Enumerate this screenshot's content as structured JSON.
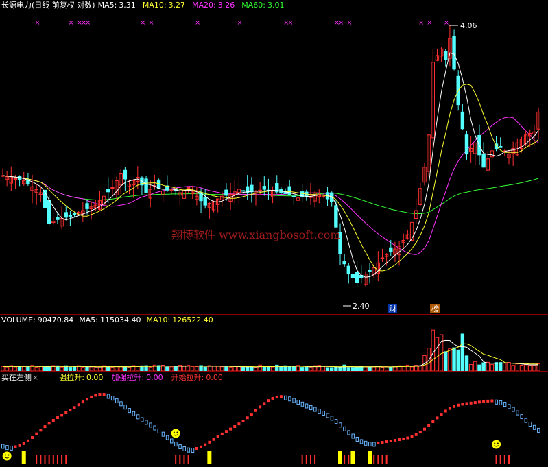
{
  "colors": {
    "background": "#000000",
    "divider": "#8b0000",
    "candle_up": "#ff3030",
    "candle_down": "#54ffff",
    "ma5": "#ffffff",
    "ma10": "#ffff33",
    "ma20": "#ff33ff",
    "ma60": "#33ff33",
    "vol_ma5": "#ffffff",
    "vol_ma10": "#ffff33",
    "indicator_red": "#ff3030",
    "indicator_blue": "#6ab6ff",
    "signal_yellow": "#ffff00",
    "watermark": "#b02020"
  },
  "price_panel": {
    "legend": {
      "title": "长源电力(日线 前复权 对数)",
      "ma5_label": "MA5:",
      "ma5_value": "3.31",
      "ma10_label": "MA10:",
      "ma10_value": "3.27",
      "ma20_label": "MA20:",
      "ma20_value": "3.26",
      "ma60_label": "MA60:",
      "ma60_value": "3.01"
    },
    "high_label": "4.06",
    "low_label": "2.40",
    "badges": [
      "财",
      "榜"
    ],
    "watermark": "翔博软件 www.xiangbosoft.com",
    "marker_glyph": "×"
  },
  "volume_panel": {
    "legend": {
      "volume_label": "VOLUME:",
      "volume_value": "90470.84",
      "ma5_label": "MA5:",
      "ma5_value": "115034.40",
      "ma10_label": "MA10:",
      "ma10_value": "126522.40"
    }
  },
  "indicator_panel": {
    "legend": {
      "name": "买在左侧",
      "close_glyph": "×",
      "strong_label": "强拉升:",
      "strong_value": "0.00",
      "enhanced_label": "加强拉升:",
      "enhanced_value": "0.00",
      "start_label": "开始拉升:",
      "start_value": "0.00"
    }
  },
  "chart_data": {
    "type": "candlestick",
    "title": "长源电力(日线 前复权 对数)",
    "scale": "log",
    "ylim": [
      2.35,
      4.12
    ],
    "visible_high": 4.06,
    "visible_low": 2.4,
    "series": [
      {
        "name": "MA5",
        "last": 3.31
      },
      {
        "name": "MA10",
        "last": 3.27
      },
      {
        "name": "MA20",
        "last": 3.26
      },
      {
        "name": "MA60",
        "last": 3.01
      }
    ],
    "volume": {
      "last": 90470.84,
      "ma5": 115034.4,
      "ma10": 126522.4
    },
    "indicator": {
      "name": "买在左侧",
      "强拉升": 0.0,
      "加强拉升": 0.0,
      "开始拉升": 0.0
    },
    "price_path": [
      [
        0,
        3.05
      ],
      [
        5,
        3.02
      ],
      [
        9,
        2.95
      ],
      [
        11,
        2.78
      ],
      [
        13,
        2.8
      ],
      [
        16,
        2.82
      ],
      [
        19,
        2.85
      ],
      [
        22,
        2.88
      ],
      [
        24,
        2.93
      ],
      [
        26,
        2.98
      ],
      [
        28,
        3.06
      ],
      [
        30,
        3.0
      ],
      [
        32,
        3.04
      ],
      [
        34,
        2.95
      ],
      [
        36,
        2.99
      ],
      [
        38,
        2.96
      ],
      [
        40,
        2.97
      ],
      [
        42,
        2.95
      ],
      [
        44,
        2.98
      ],
      [
        46,
        2.93
      ],
      [
        48,
        2.88
      ],
      [
        50,
        2.9
      ],
      [
        52,
        2.93
      ],
      [
        54,
        2.94
      ],
      [
        56,
        2.97
      ],
      [
        58,
        2.95
      ],
      [
        60,
        2.96
      ],
      [
        62,
        2.97
      ],
      [
        64,
        2.96
      ],
      [
        66,
        2.95
      ],
      [
        68,
        2.94
      ],
      [
        70,
        2.92
      ],
      [
        72,
        2.93
      ],
      [
        74,
        2.95
      ],
      [
        76,
        2.93
      ],
      [
        78,
        2.9
      ],
      [
        80,
        2.62
      ],
      [
        82,
        2.52
      ],
      [
        84,
        2.48
      ],
      [
        86,
        2.52
      ],
      [
        88,
        2.55
      ],
      [
        90,
        2.6
      ],
      [
        92,
        2.63
      ],
      [
        94,
        2.66
      ],
      [
        96,
        2.72
      ],
      [
        98,
        2.85
      ],
      [
        100,
        3.1
      ],
      [
        101,
        3.3
      ],
      [
        102,
        3.8
      ],
      [
        103,
        3.85
      ],
      [
        104,
        3.9
      ],
      [
        105,
        3.82
      ],
      [
        106,
        3.98
      ],
      [
        107,
        3.75
      ],
      [
        108,
        3.5
      ],
      [
        110,
        3.18
      ],
      [
        112,
        3.25
      ],
      [
        114,
        3.1
      ],
      [
        116,
        3.2
      ],
      [
        118,
        3.22
      ],
      [
        120,
        3.18
      ],
      [
        122,
        3.25
      ],
      [
        124,
        3.3
      ],
      [
        126,
        3.32
      ],
      [
        127,
        3.45
      ]
    ]
  }
}
